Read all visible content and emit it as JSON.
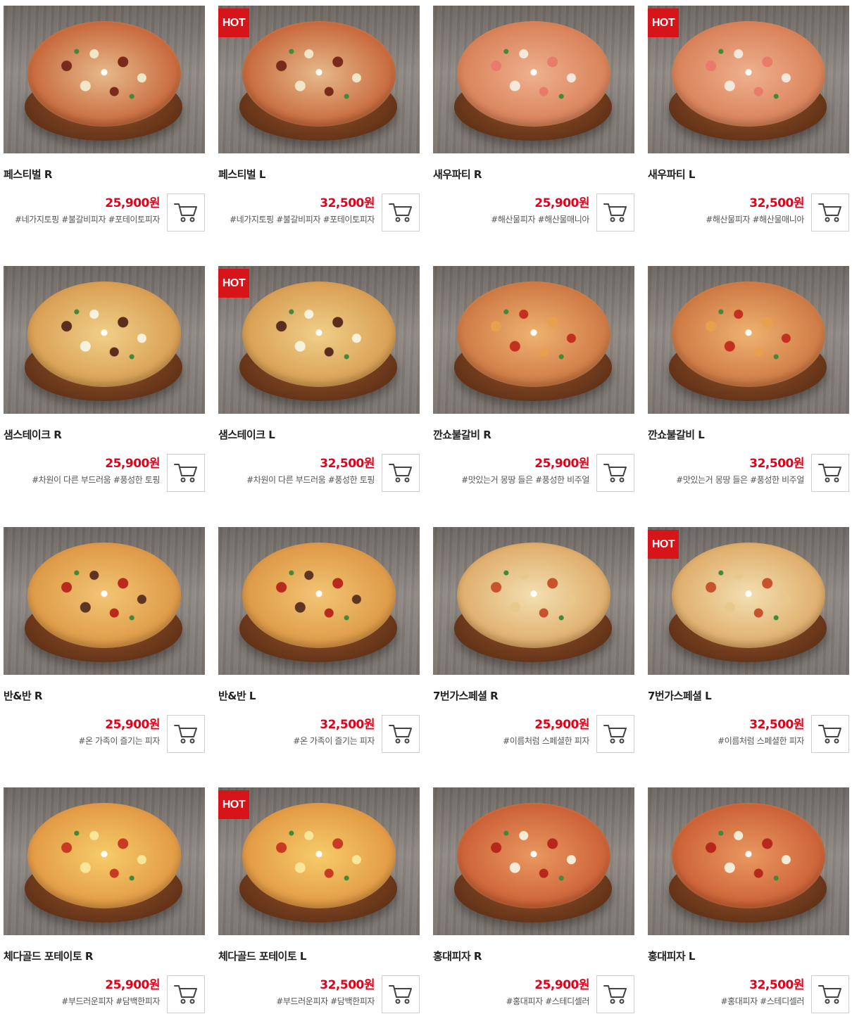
{
  "products": [
    {
      "name": "페스티벌 R",
      "price": "25,900원",
      "tags": "#네가지토핑 #불갈비피자 #포테이토피자",
      "hot": false,
      "hot_label": "",
      "colors": {
        "c1": "#c86a3e",
        "c2": "#e7b98a",
        "t1": "#7a2a18",
        "t2": "#f1e6c8"
      }
    },
    {
      "name": "페스티벌 L",
      "price": "32,500원",
      "tags": "#네가지토핑 #불갈비피자 #포테이토피자",
      "hot": true,
      "hot_label": "HOT",
      "colors": {
        "c1": "#c86a3e",
        "c2": "#e7b98a",
        "t1": "#7a2a18",
        "t2": "#f1e6c8"
      }
    },
    {
      "name": "새우파티 R",
      "price": "25,900원",
      "tags": "#해산물피자 #해산물매니아",
      "hot": false,
      "hot_label": "",
      "colors": {
        "c1": "#d9825a",
        "c2": "#efb08d",
        "t1": "#e97b6a",
        "t2": "#f4e7dc"
      }
    },
    {
      "name": "새우파티 L",
      "price": "32,500원",
      "tags": "#해산물피자 #해산물매니아",
      "hot": true,
      "hot_label": "HOT",
      "colors": {
        "c1": "#d9825a",
        "c2": "#efb08d",
        "t1": "#e97b6a",
        "t2": "#f4e7dc"
      }
    },
    {
      "name": "샘스테이크 R",
      "price": "25,900원",
      "tags": "#차원이 다른 부드러움 #풍성한 토핑",
      "hot": false,
      "hot_label": "",
      "colors": {
        "c1": "#d9a055",
        "c2": "#f0cf88",
        "t1": "#5b2d1c",
        "t2": "#f7f2e0"
      }
    },
    {
      "name": "샘스테이크 L",
      "price": "32,500원",
      "tags": "#차원이 다른 부드러움 #풍성한 토핑",
      "hot": true,
      "hot_label": "HOT",
      "colors": {
        "c1": "#d9a055",
        "c2": "#f0cf88",
        "t1": "#5b2d1c",
        "t2": "#f7f2e0"
      }
    },
    {
      "name": "깐쇼불갈비 R",
      "price": "25,900원",
      "tags": "#맛있는거 몽땅 들은 #풍성한 비주얼",
      "hot": false,
      "hot_label": "",
      "colors": {
        "c1": "#cf7a45",
        "c2": "#eeb270",
        "t1": "#e7a14e",
        "t2": "#c3301d"
      }
    },
    {
      "name": "깐쇼불갈비 L",
      "price": "32,500원",
      "tags": "#맛있는거 몽땅 들은 #풍성한 비주얼",
      "hot": false,
      "hot_label": "",
      "colors": {
        "c1": "#cf7a45",
        "c2": "#eeb270",
        "t1": "#e7a14e",
        "t2": "#c3301d"
      }
    },
    {
      "name": "반&반 R",
      "price": "25,900원",
      "tags": "#온 가족이 즐기는 피자",
      "hot": false,
      "hot_label": "",
      "colors": {
        "c1": "#de9a48",
        "c2": "#f2c574",
        "t1": "#b92a1d",
        "t2": "#5c3622"
      }
    },
    {
      "name": "반&반 L",
      "price": "32,500원",
      "tags": "#온 가족이 즐기는 피자",
      "hot": false,
      "hot_label": "",
      "colors": {
        "c1": "#de9a48",
        "c2": "#f2c574",
        "t1": "#b92a1d",
        "t2": "#5c3622"
      }
    },
    {
      "name": "7번가스페셜 R",
      "price": "25,900원",
      "tags": "#이름처럼 스페셜한 피자",
      "hot": false,
      "hot_label": "",
      "colors": {
        "c1": "#dfae6d",
        "c2": "#f3dfb0",
        "t1": "#c6522e",
        "t2": "#e8c98c"
      }
    },
    {
      "name": "7번가스페셜 L",
      "price": "32,500원",
      "tags": "#이름처럼 스페셜한 피자",
      "hot": true,
      "hot_label": "HOT",
      "colors": {
        "c1": "#dfae6d",
        "c2": "#f3dfb0",
        "t1": "#c6522e",
        "t2": "#e8c98c"
      }
    },
    {
      "name": "체다골드 포테이토 R",
      "price": "25,900원",
      "tags": "#부드러운피자 #담백한피자",
      "hot": false,
      "hot_label": "",
      "colors": {
        "c1": "#e39b45",
        "c2": "#f6cc6a",
        "t1": "#c93a22",
        "t2": "#f8e79a"
      }
    },
    {
      "name": "체다골드 포테이토 L",
      "price": "32,500원",
      "tags": "#부드러운피자 #담백한피자",
      "hot": true,
      "hot_label": "HOT",
      "colors": {
        "c1": "#e39b45",
        "c2": "#f6cc6a",
        "t1": "#c93a22",
        "t2": "#f8e79a"
      }
    },
    {
      "name": "홍대피자 R",
      "price": "25,900원",
      "tags": "#홍대피자 #스테디셀러",
      "hot": false,
      "hot_label": "",
      "colors": {
        "c1": "#cd6238",
        "c2": "#e99860",
        "t1": "#b8281a",
        "t2": "#f5ecd8"
      }
    },
    {
      "name": "홍대피자 L",
      "price": "32,500원",
      "tags": "#홍대피자 #스테디셀러",
      "hot": false,
      "hot_label": "",
      "colors": {
        "c1": "#cd6238",
        "c2": "#e99860",
        "t1": "#b8281a",
        "t2": "#f5ecd8"
      }
    }
  ],
  "icons": {
    "cart": "shopping-cart-icon"
  }
}
